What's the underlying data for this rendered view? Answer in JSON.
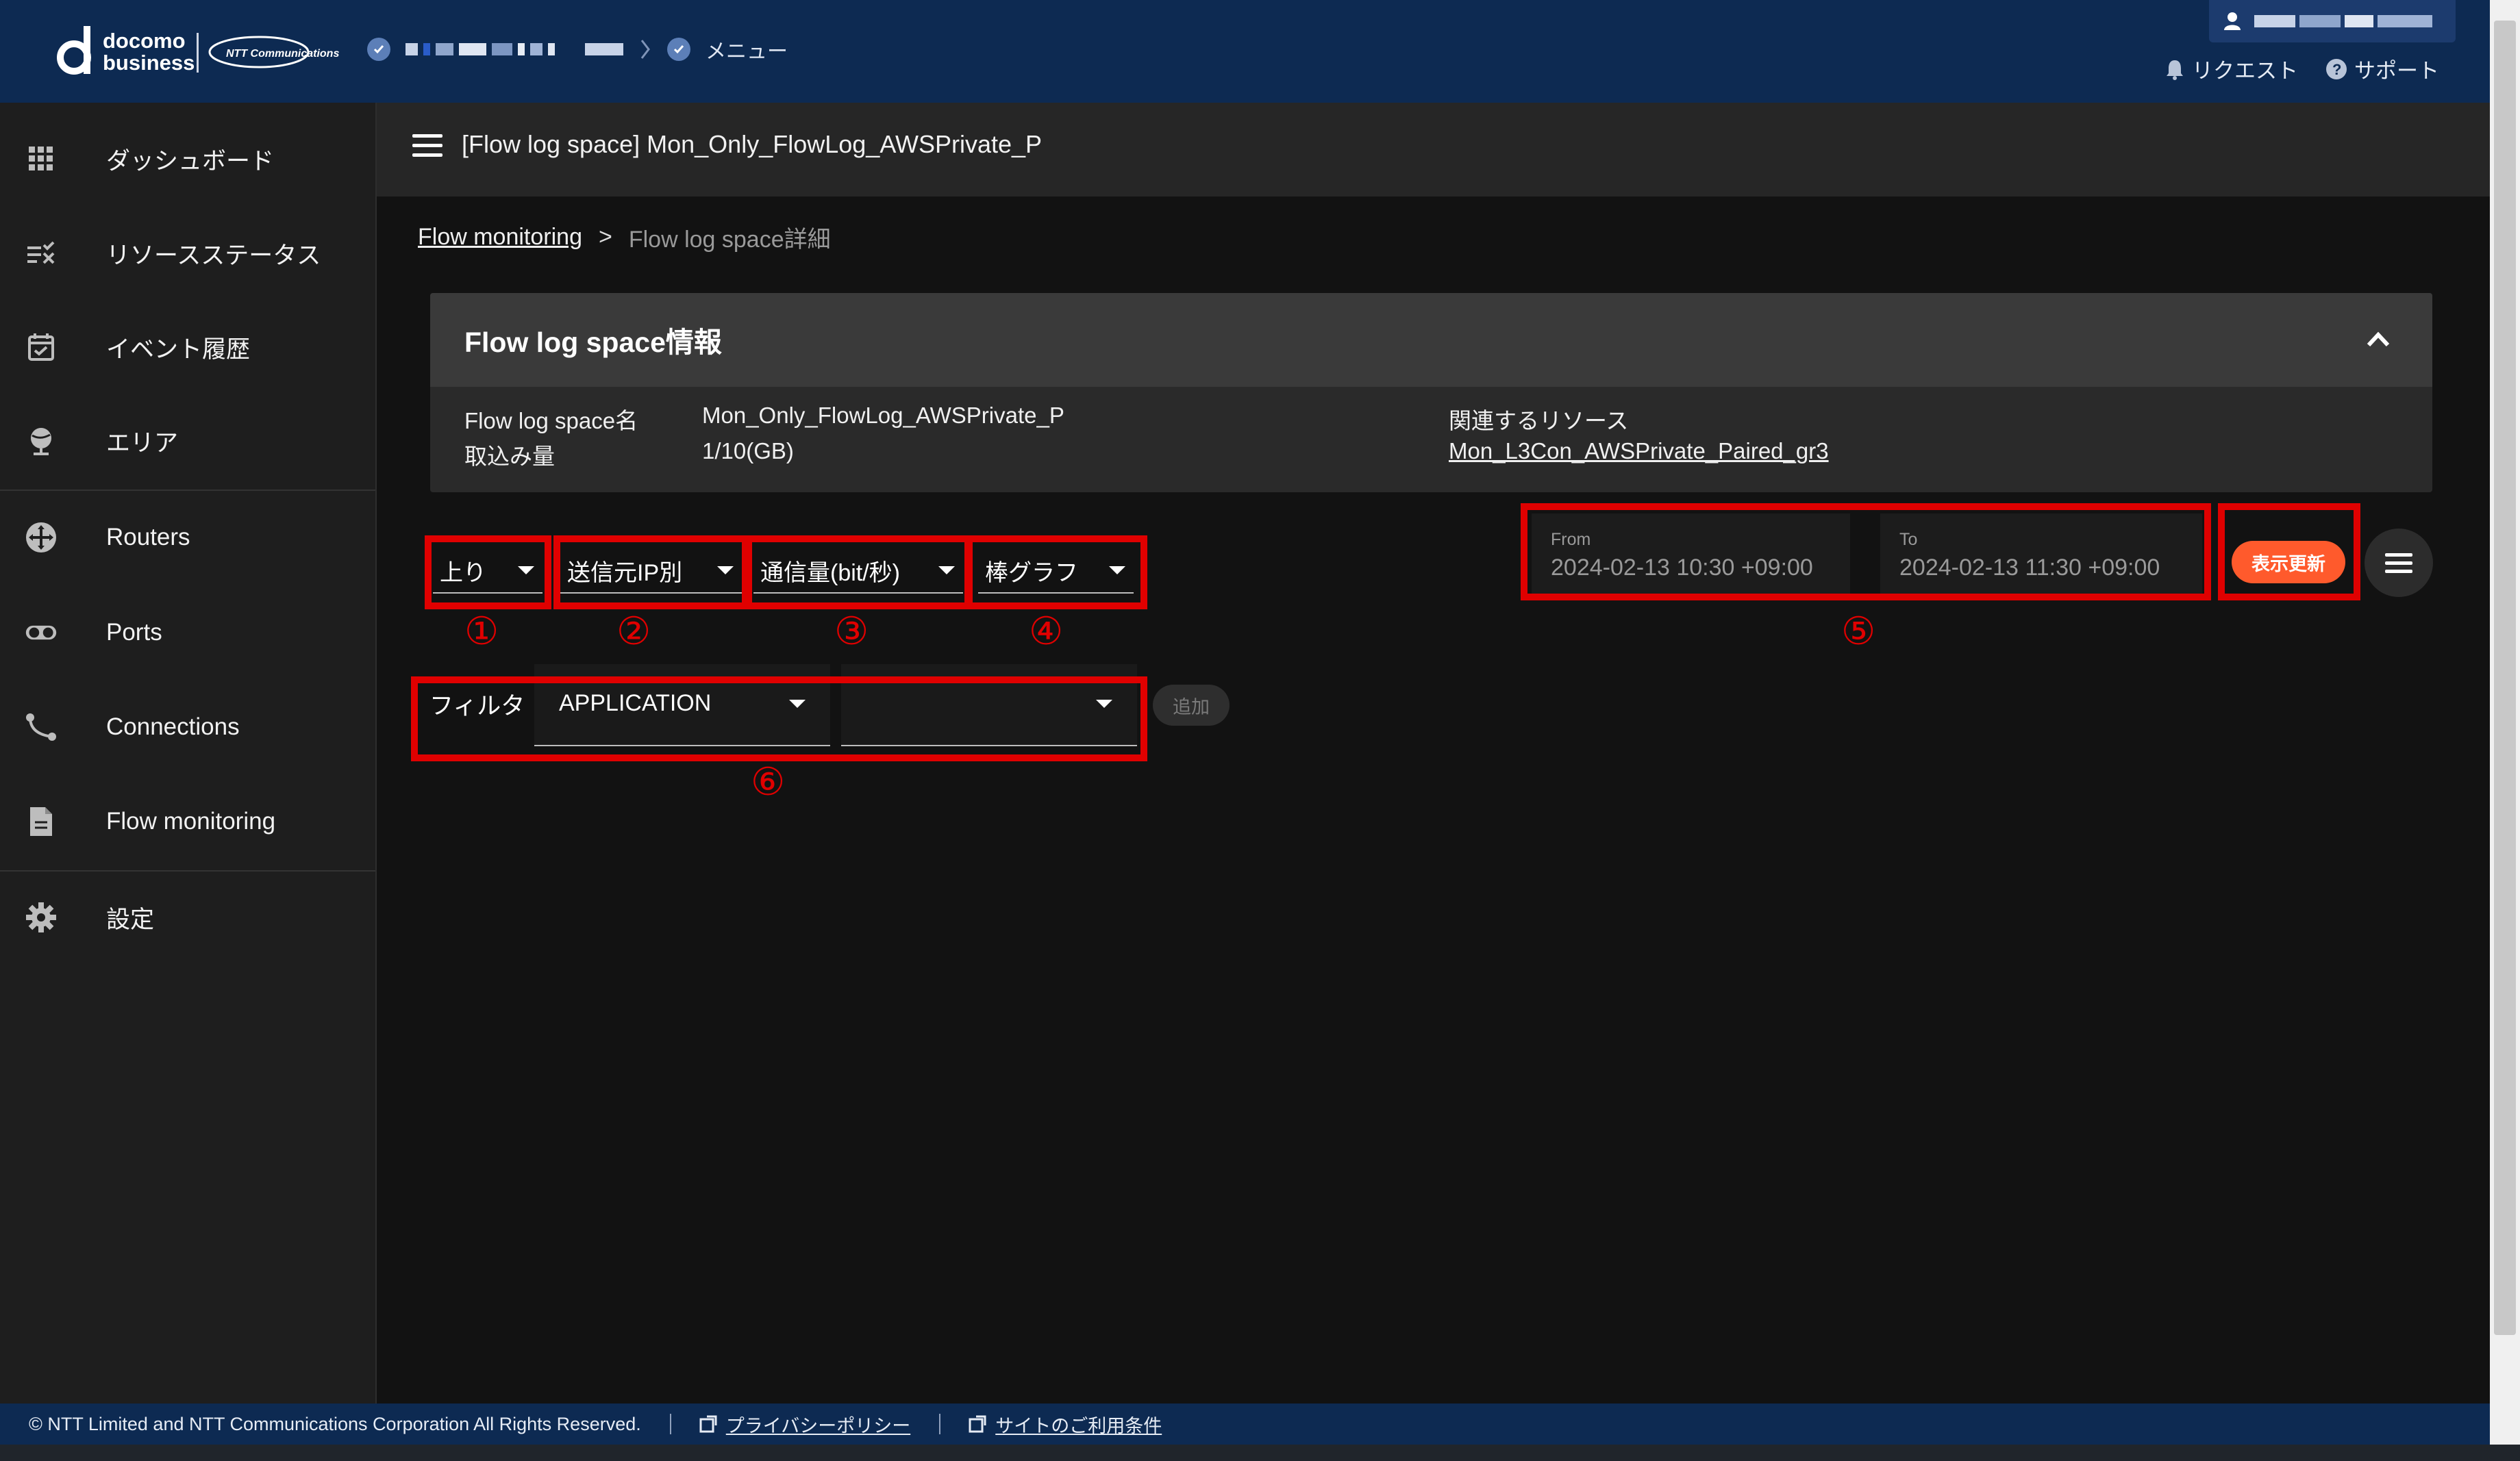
{
  "brand": {
    "logo_line1": "docomo",
    "logo_line2": "business",
    "ntt_logo_text": "NTT Communications"
  },
  "top": {
    "menu_label": "メニュー",
    "request_label": "リクエスト",
    "support_label": "サポート"
  },
  "sidebar": {
    "items": [
      {
        "label": "ダッシュボード",
        "icon": "grid-icon"
      },
      {
        "label": "リソースステータス",
        "icon": "status-list-icon"
      },
      {
        "label": "イベント履歴",
        "icon": "calendar-check-icon"
      },
      {
        "label": "エリア",
        "icon": "globe-pin-icon"
      },
      {
        "label": "Routers",
        "icon": "router-icon"
      },
      {
        "label": "Ports",
        "icon": "port-toggle-icon"
      },
      {
        "label": "Connections",
        "icon": "connection-icon"
      },
      {
        "label": "Flow monitoring",
        "icon": "document-icon"
      },
      {
        "label": "設定",
        "icon": "gear-icon"
      }
    ]
  },
  "header": {
    "title": "[Flow log space] Mon_Only_FlowLog_AWSPrivate_P"
  },
  "breadcrumb": {
    "link": "Flow monitoring",
    "separator": ">",
    "current": "Flow log space詳細"
  },
  "info": {
    "title": "Flow log space情報",
    "name_label": "Flow log space名",
    "name_value": "Mon_Only_FlowLog_AWSPrivate_P",
    "volume_label": "取込み量",
    "volume_value": "1/10(GB)",
    "related_label": "関連するリソース",
    "related_link": "Mon_L3Con_AWSPrivate_Paired_gr3"
  },
  "controls": {
    "direction": "上り",
    "group_by": "送信元IP別",
    "metric": "通信量(bit/秒)",
    "chart_type": "棒グラフ",
    "from_label": "From",
    "from_value": "2024-02-13 10:30 +09:00",
    "to_label": "To",
    "to_value": "2024-02-13 11:30 +09:00",
    "refresh_label": "表示更新",
    "filter_label": "フィルタ",
    "filter_field": "APPLICATION",
    "filter_value": "",
    "add_label": "追加"
  },
  "annotations": [
    "①",
    "②",
    "③",
    "④",
    "⑤",
    "⑥"
  ],
  "footer": {
    "copyright": "© NTT Limited and NTT Communications Corporation All Rights Reserved.",
    "privacy": "プライバシーポリシー",
    "terms": "サイトのご利用条件"
  },
  "colors": {
    "accent": "#ff5a2c",
    "annotation": "#e00000",
    "topbar": "#0d2a52"
  }
}
